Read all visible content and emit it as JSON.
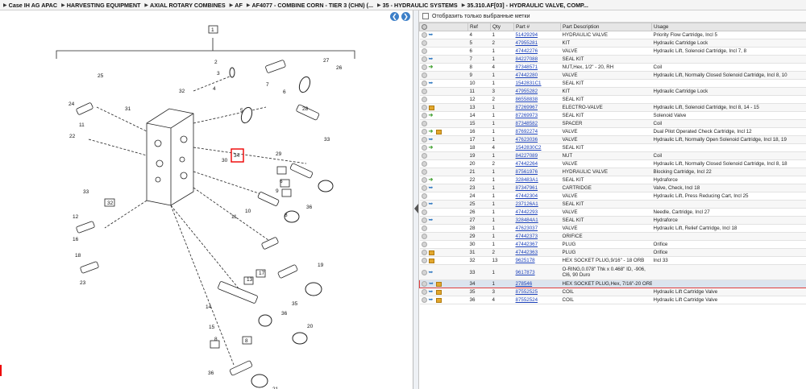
{
  "breadcrumb": [
    "Case IH AG APAC",
    "HARVESTING EQUIPMENT",
    "AXIAL ROTARY COMBINES",
    "AF",
    "AF4077 - COMBINE CORN - TIER 3 (CHN) (...",
    "35 - HYDRAULIC SYSTEMS",
    "35.310.AF[03] - HYDRAULIC VALVE, COMP..."
  ],
  "filter_label": "Отобразить только выбранные метки",
  "columns": [
    "Ref",
    "Qty",
    "Part #",
    "Part Description",
    "Usage"
  ],
  "rows": [
    {
      "ref": "4",
      "qty": "1",
      "part": "51429294",
      "desc": "HYDRAULIC VALVE",
      "usage": "Priority Flow Cartridge, Incl 5",
      "icons": [
        "circle",
        "wrench"
      ]
    },
    {
      "ref": "5",
      "qty": "2",
      "part": "47955281",
      "desc": "KIT",
      "usage": "Hydraulic Cartridge Lock",
      "icons": [
        "circle"
      ]
    },
    {
      "ref": "6",
      "qty": "1",
      "part": "47442276",
      "desc": "VALVE",
      "usage": "Hydraulic Lift, Solenoid Cartridge, Incl 7, 8",
      "icons": [
        "circle"
      ]
    },
    {
      "ref": "7",
      "qty": "1",
      "part": "84227088",
      "desc": "SEAL KIT",
      "usage": "",
      "icons": [
        "circle",
        "wrench"
      ]
    },
    {
      "ref": "8",
      "qty": "4",
      "part": "87348571",
      "desc": "NUT,Hex, 1/2\" - 20, RH",
      "usage": "Coil",
      "icons": [
        "circle",
        "arrow"
      ]
    },
    {
      "ref": "9",
      "qty": "1",
      "part": "47442280",
      "desc": "VALVE",
      "usage": "Hydraulic Lift, Normally Closed Solenoid Cartridge, Incl 8, 10",
      "icons": [
        "circle"
      ]
    },
    {
      "ref": "10",
      "qty": "1",
      "part": "1542831C1",
      "desc": "SEAL KIT",
      "usage": "",
      "icons": [
        "circle",
        "wrench"
      ]
    },
    {
      "ref": "11",
      "qty": "3",
      "part": "47955282",
      "desc": "KIT",
      "usage": "Hydraulic Cartridge Lock",
      "icons": [
        "circle"
      ]
    },
    {
      "ref": "12",
      "qty": "2",
      "part": "86558838",
      "desc": "SEAL KIT",
      "usage": "",
      "icons": [
        "circle"
      ]
    },
    {
      "ref": "13",
      "qty": "1",
      "part": "87269967",
      "desc": "ELECTRO-VALVE",
      "usage": "Hydraulic Lift, Solenoid Cartridge, Incl 8, 14 - 15",
      "icons": [
        "circle",
        "box"
      ]
    },
    {
      "ref": "14",
      "qty": "1",
      "part": "87269973",
      "desc": "SEAL KIT",
      "usage": "Solenoid Valve",
      "icons": [
        "circle",
        "arrow"
      ]
    },
    {
      "ref": "15",
      "qty": "1",
      "part": "87348582",
      "desc": "SPACER",
      "usage": "Coil",
      "icons": [
        "circle"
      ]
    },
    {
      "ref": "16",
      "qty": "1",
      "part": "87692274",
      "desc": "VALVE",
      "usage": "Dual Pilot Operated Check Cartridge, Incl 12",
      "icons": [
        "circle",
        "arrow",
        "box"
      ]
    },
    {
      "ref": "17",
      "qty": "1",
      "part": "47623036",
      "desc": "VALVE",
      "usage": "Hydraulic Lift, Normally Open Solenoid Cartridge, Incl 18, 19",
      "icons": [
        "circle",
        "wrench"
      ]
    },
    {
      "ref": "18",
      "qty": "4",
      "part": "1542830C2",
      "desc": "SEAL KIT",
      "usage": "",
      "icons": [
        "circle",
        "arrow"
      ]
    },
    {
      "ref": "19",
      "qty": "1",
      "part": "84227089",
      "desc": "NUT",
      "usage": "Coil",
      "icons": [
        "circle"
      ]
    },
    {
      "ref": "20",
      "qty": "2",
      "part": "47442264",
      "desc": "VALVE",
      "usage": "Hydraulic Lift, Normally Closed Solenoid Cartridge, Incl 8, 18",
      "icons": [
        "circle"
      ]
    },
    {
      "ref": "21",
      "qty": "1",
      "part": "87561976",
      "desc": "HYDRAULIC VALVE",
      "usage": "Blocking Cartridge, Incl 22",
      "icons": [
        "circle"
      ]
    },
    {
      "ref": "22",
      "qty": "1",
      "part": "328483A1",
      "desc": "SEAL KIT",
      "usage": "Hydraforce",
      "icons": [
        "circle",
        "arrow"
      ]
    },
    {
      "ref": "23",
      "qty": "1",
      "part": "87347961",
      "desc": "CARTRIDGE",
      "usage": "Valve, Check, Incl 18",
      "icons": [
        "circle",
        "wrench"
      ]
    },
    {
      "ref": "24",
      "qty": "1",
      "part": "47442304",
      "desc": "VALVE",
      "usage": "Hydraulic Lift, Press Reducing Cart, Incl 25",
      "icons": [
        "circle"
      ]
    },
    {
      "ref": "25",
      "qty": "1",
      "part": "237126A1",
      "desc": "SEAL KIT",
      "usage": "",
      "icons": [
        "circle",
        "wrench"
      ]
    },
    {
      "ref": "26",
      "qty": "1",
      "part": "47442293",
      "desc": "VALVE",
      "usage": "Needle, Cartridge, Incl 27",
      "icons": [
        "circle"
      ]
    },
    {
      "ref": "27",
      "qty": "1",
      "part": "328484A1",
      "desc": "SEAL KIT",
      "usage": "Hydraforce",
      "icons": [
        "circle",
        "wrench"
      ]
    },
    {
      "ref": "28",
      "qty": "1",
      "part": "47623037",
      "desc": "VALVE",
      "usage": "Hydraulic Lift, Relief Cartridge, Incl 18",
      "icons": [
        "circle"
      ]
    },
    {
      "ref": "29",
      "qty": "1",
      "part": "47442373",
      "desc": "ORIFICE",
      "usage": "",
      "icons": [
        "circle"
      ]
    },
    {
      "ref": "30",
      "qty": "1",
      "part": "47442367",
      "desc": "PLUG",
      "usage": "Orifice",
      "icons": [
        "circle"
      ]
    },
    {
      "ref": "31",
      "qty": "2",
      "part": "47442363",
      "desc": "PLUG",
      "usage": "Orifice",
      "icons": [
        "circle",
        "box"
      ]
    },
    {
      "ref": "32",
      "qty": "13",
      "part": "9625178",
      "desc": "HEX SOCKET PLUG,9/16\" - 18 ORB",
      "usage": "Incl 33",
      "icons": [
        "circle",
        "box"
      ]
    },
    {
      "ref": "33",
      "qty": "1",
      "part": "9617873",
      "desc": "O-RING,0.078\" Thk x 0.468\" ID, -906, Cl6, 90 Duro",
      "usage": "",
      "icons": [
        "circle",
        "wrench"
      ],
      "tall": true
    },
    {
      "ref": "34",
      "qty": "1",
      "part": "278546",
      "desc": "HEX SOCKET PLUG,Hex, 7/16\"-20 ORB",
      "usage": "",
      "icons": [
        "circle",
        "wrench",
        "box"
      ],
      "selected": true
    },
    {
      "ref": "35",
      "qty": "3",
      "part": "87552525",
      "desc": "COIL",
      "usage": "Hydraulic Lift Cartridge Valve",
      "icons": [
        "circle",
        "wrench",
        "box"
      ]
    },
    {
      "ref": "36",
      "qty": "4",
      "part": "87552524",
      "desc": "COIL",
      "usage": "Hydraulic Lift Cartridge Valve",
      "icons": [
        "circle",
        "wrench",
        "box"
      ]
    }
  ],
  "diagram_callouts": [
    "1",
    "25",
    "24",
    "31",
    "22",
    "11",
    "33",
    "32",
    "12",
    "16",
    "23",
    "18",
    "2",
    "3",
    "4",
    "5",
    "6",
    "27",
    "26",
    "7",
    "32",
    "28",
    "33",
    "30",
    "34",
    "29",
    "9",
    "10",
    "11",
    "8",
    "6",
    "36",
    "17",
    "13",
    "19",
    "14",
    "15",
    "8",
    "35",
    "36",
    "20",
    "8",
    "36",
    "21"
  ]
}
